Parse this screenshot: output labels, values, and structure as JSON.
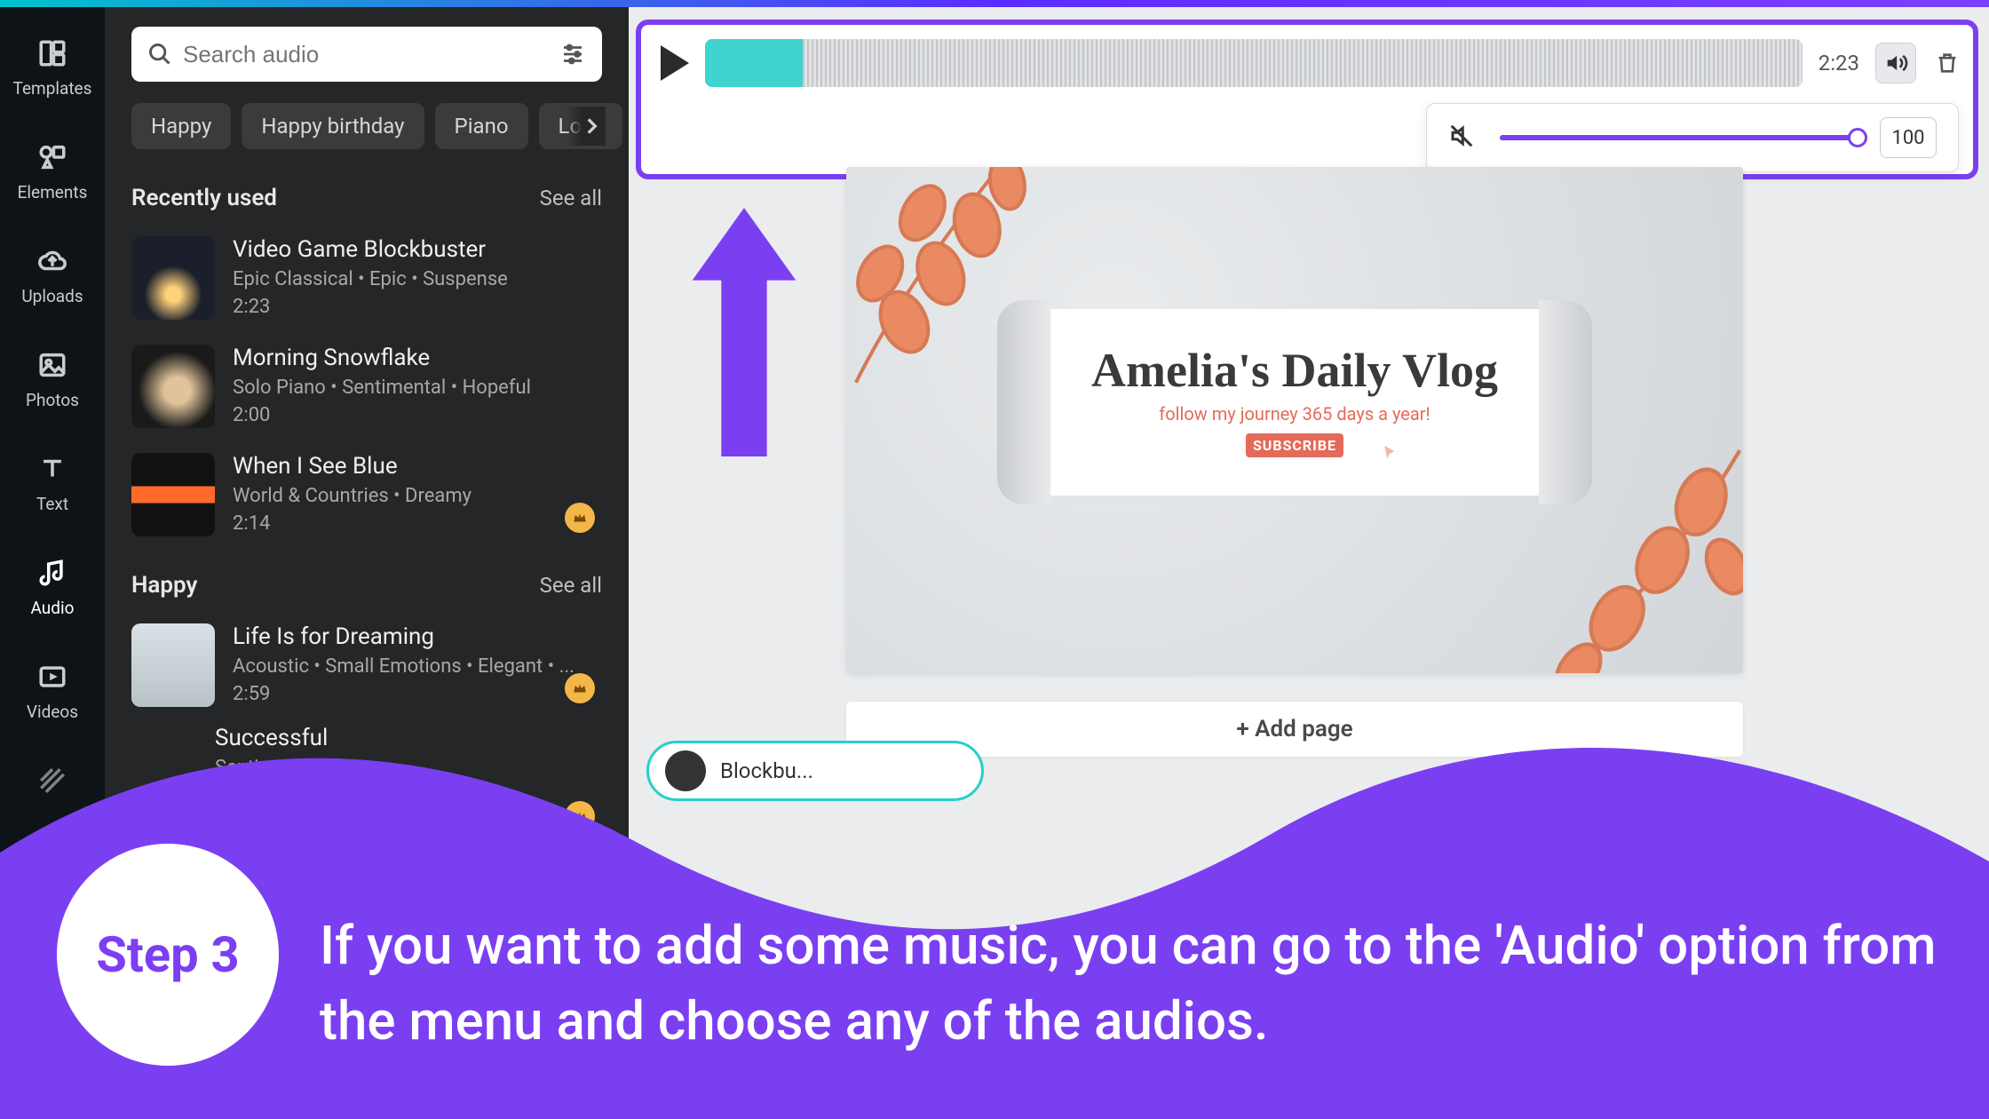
{
  "search": {
    "placeholder": "Search audio"
  },
  "rail": {
    "templates": "Templates",
    "elements": "Elements",
    "uploads": "Uploads",
    "photos": "Photos",
    "text": "Text",
    "audio": "Audio",
    "videos": "Videos"
  },
  "chips": {
    "c1": "Happy",
    "c2": "Happy birthday",
    "c3": "Piano",
    "c4": "Love"
  },
  "sections": {
    "recent": {
      "title": "Recently used",
      "seeall": "See all"
    },
    "happy": {
      "title": "Happy",
      "seeall": "See all"
    }
  },
  "tracks": {
    "r1": {
      "name": "Video Game Blockbuster",
      "desc": "Epic Classical • Epic • Suspense",
      "dur": "2:23"
    },
    "r2": {
      "name": "Morning Snowflake",
      "desc": "Solo Piano • Sentimental • Hopeful",
      "dur": "2:00"
    },
    "r3": {
      "name": "When I See Blue",
      "desc": "World & Countries • Dreamy",
      "dur": "2:14"
    },
    "h1": {
      "name": "Life Is for Dreaming",
      "desc": "Acoustic • Small Emotions • Elegant • ...",
      "dur": "2:59"
    },
    "h2": {
      "name": "Successful",
      "desc": "Sentimental",
      "dur": ""
    }
  },
  "audiobar": {
    "time": "2:23",
    "volume": "100"
  },
  "page": {
    "title": "Amelia's Daily Vlog",
    "subtitle": "follow my journey 365 days a year!",
    "subscribe": "SUBSCRIBE"
  },
  "addpage": "+ Add page",
  "pill": {
    "label": "Blockbu..."
  },
  "step": {
    "badge": "Step 3",
    "text": "If you want to add some music, you can go to the 'Audio' option from the menu and choose any of the audios."
  }
}
